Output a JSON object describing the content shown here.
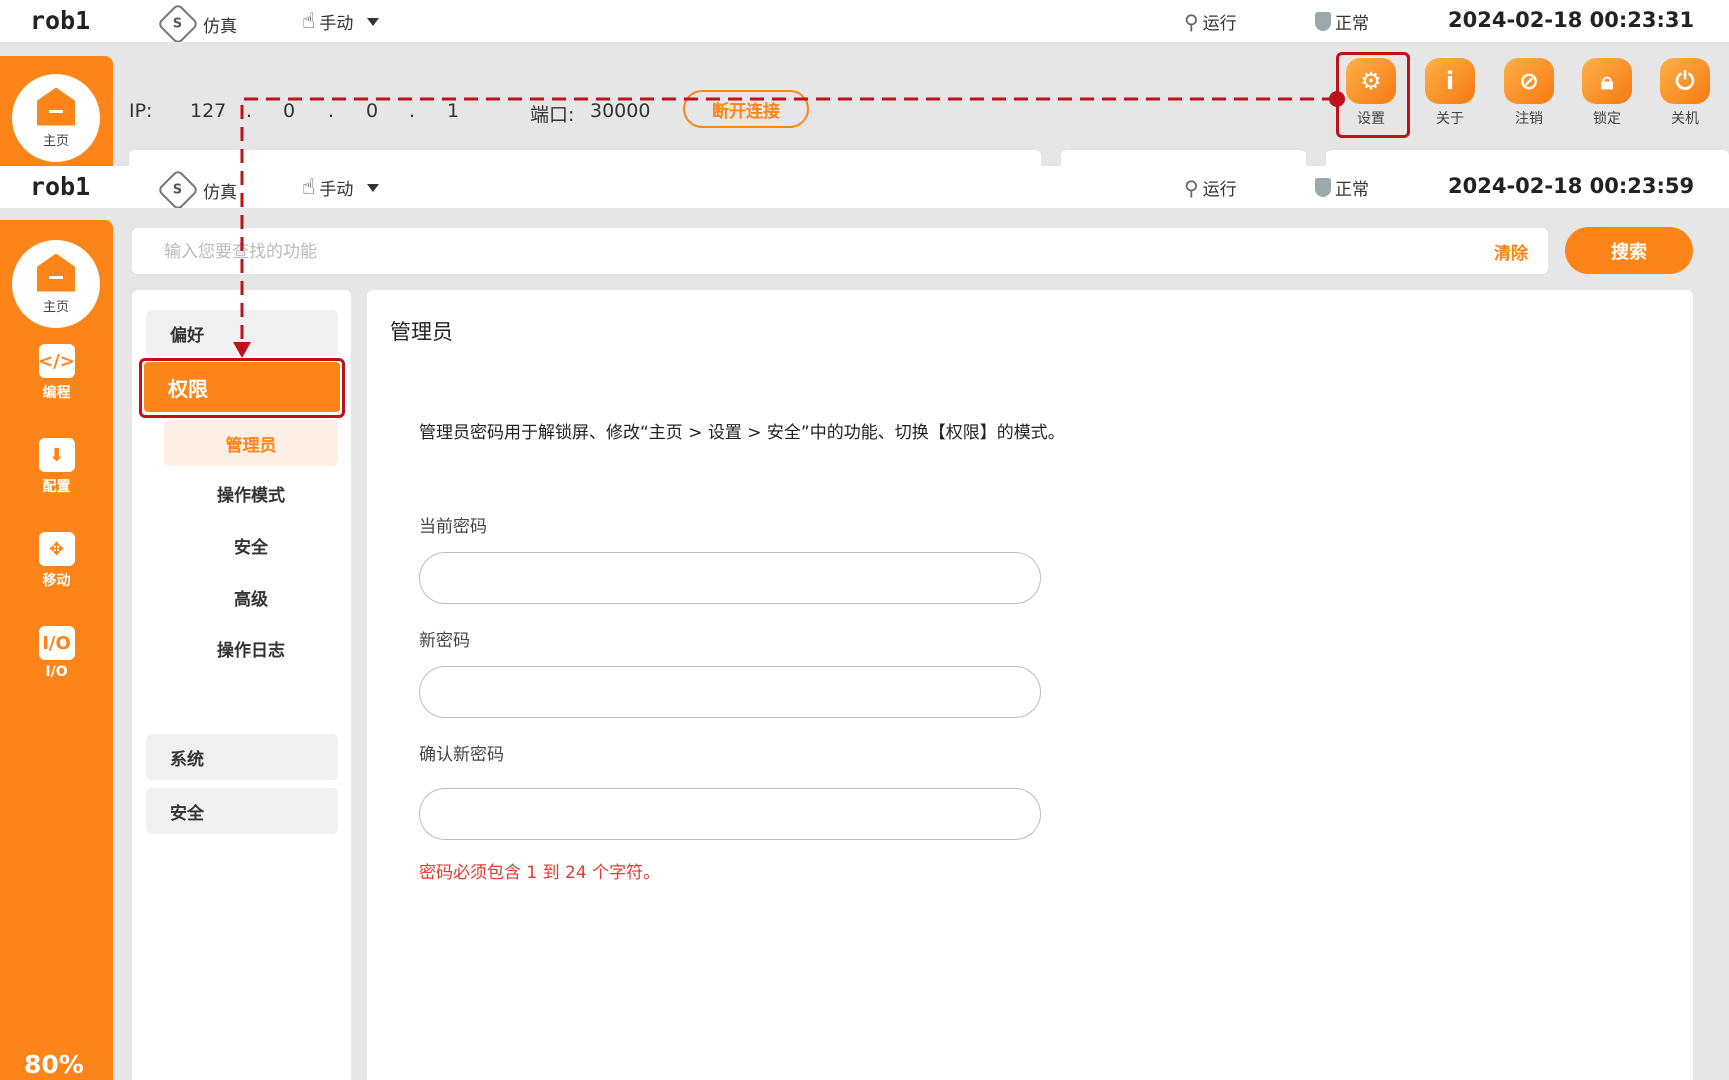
{
  "screen1": {
    "robot_name": "rob1",
    "sim_label": "仿真",
    "mode_label": "手动",
    "run_label": "运行",
    "status_label": "正常",
    "datetime": "2024-02-18 00:23:31",
    "home_label": "主页",
    "ip_label": "IP:",
    "ip_parts": [
      "127",
      ".",
      "0",
      ".",
      "0",
      ".",
      "1"
    ],
    "port_label": "端口:",
    "port_value": "30000",
    "disconnect_label": "断开连接",
    "tools": [
      {
        "label": "设置",
        "icon": "gear-icon"
      },
      {
        "label": "关于",
        "icon": "info-icon"
      },
      {
        "label": "注销",
        "icon": "logout-icon"
      },
      {
        "label": "锁定",
        "icon": "lock-icon"
      },
      {
        "label": "关机",
        "icon": "power-icon"
      }
    ]
  },
  "screen2": {
    "robot_name": "rob1",
    "sim_label": "仿真",
    "mode_label": "手动",
    "run_label": "运行",
    "status_label": "正常",
    "datetime": "2024-02-18 00:23:59",
    "nav": [
      {
        "label": "主页",
        "icon": "home-icon"
      },
      {
        "label": "编程",
        "icon": "code-icon"
      },
      {
        "label": "配置",
        "icon": "download-config-icon"
      },
      {
        "label": "移动",
        "icon": "move-icon"
      },
      {
        "label": "I/O",
        "icon": "io-icon"
      }
    ],
    "battery": "80%",
    "search": {
      "placeholder": "输入您要查找的功能",
      "clear_label": "清除",
      "button_label": "搜索"
    },
    "settings_menu": {
      "preferences": "偏好",
      "permissions": "权限",
      "permissions_items": [
        "管理员",
        "操作模式",
        "安全",
        "高级",
        "操作日志"
      ],
      "system": "系统",
      "security": "安全"
    },
    "admin": {
      "title": "管理员",
      "description": "管理员密码用于解锁屏、修改“主页 > 设置 > 安全”中的功能、切换【权限】的模式。",
      "current_password_label": "当前密码",
      "new_password_label": "新密码",
      "confirm_password_label": "确认新密码",
      "error_text": "密码必须包含 1 到 24 个字符。"
    }
  },
  "colors": {
    "accent": "#fd8418",
    "annotation_red": "#c0101a",
    "error_red": "#e53935",
    "panel_bg": "#e6e6e6"
  }
}
